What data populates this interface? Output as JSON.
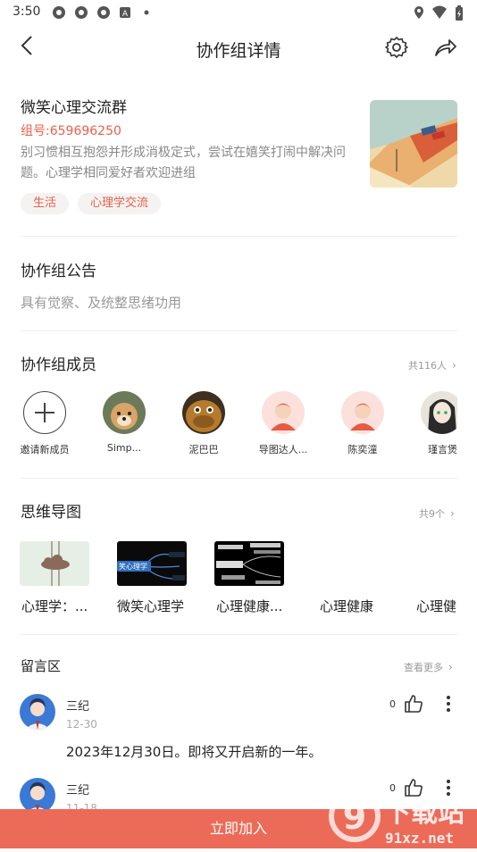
{
  "status_bar": {
    "time": "3:50"
  },
  "nav": {
    "title": "协作组详情"
  },
  "group": {
    "name": "微笑心理交流群",
    "id_text": "组号:659696250",
    "description": "别习惯相互抱怨并形成消极定式，尝试在嬉笑打闹中解决问题。心理学相同爱好者欢迎进组",
    "tags": [
      "生活",
      "心理学交流"
    ]
  },
  "notice": {
    "title": "协作组公告",
    "text": "具有觉察、及统整思绪功用"
  },
  "members": {
    "title": "协作组成员",
    "count_text": "共116人",
    "items": [
      {
        "name": "邀请新成员"
      },
      {
        "name": "Simp..."
      },
      {
        "name": "泥巴巴"
      },
      {
        "name": "导图达人..."
      },
      {
        "name": "陈奕潼"
      },
      {
        "name": "瑾言煲"
      }
    ]
  },
  "mindmaps": {
    "title": "思维导图",
    "count_text": "共9个",
    "items": [
      {
        "label": "心理学：..."
      },
      {
        "label": "微笑心理学"
      },
      {
        "label": "心理健康..."
      },
      {
        "label": "心理健康"
      },
      {
        "label": "心理健"
      }
    ],
    "thumb_text": [
      "笑心理学"
    ]
  },
  "comments": {
    "title": "留言区",
    "more_text": "查看更多",
    "items": [
      {
        "user": "三纪",
        "date": "12-30",
        "text": "2023年12月30日。即将又开启新的一年。",
        "likes": "0"
      },
      {
        "user": "三纪",
        "date": "11-18",
        "text": "",
        "likes": "0"
      }
    ]
  },
  "join": {
    "label": "立即加入"
  },
  "watermark": {
    "text": "下载站",
    "domain": "91xz.net"
  },
  "colors": {
    "accent": "#e8604a",
    "join_bar": "#ec6b58"
  }
}
